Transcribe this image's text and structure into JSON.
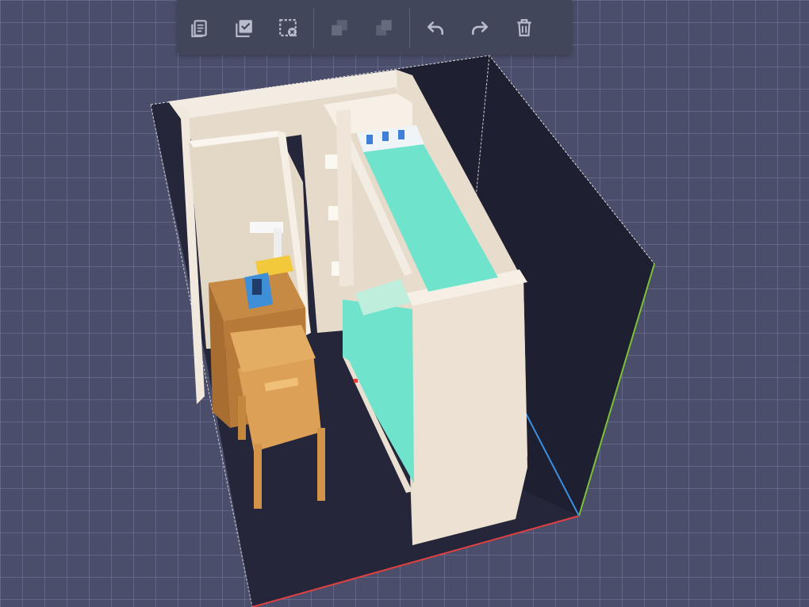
{
  "app": {
    "view": "3d-voxel-editor"
  },
  "toolbar": {
    "groups": [
      [
        {
          "name": "copy-button",
          "icon": "copy-document-icon",
          "enabled": true
        },
        {
          "name": "select-all-button",
          "icon": "select-all-icon",
          "enabled": true
        },
        {
          "name": "deselect-button",
          "icon": "deselect-icon",
          "enabled": true
        }
      ],
      [
        {
          "name": "bring-to-front-button",
          "icon": "bring-to-front-icon",
          "enabled": false
        },
        {
          "name": "send-to-back-button",
          "icon": "send-to-back-icon",
          "enabled": false
        }
      ],
      [
        {
          "name": "undo-button",
          "icon": "undo-icon",
          "enabled": true
        },
        {
          "name": "redo-button",
          "icon": "redo-icon",
          "enabled": true
        },
        {
          "name": "delete-button",
          "icon": "trash-icon",
          "enabled": true
        }
      ]
    ],
    "colors": {
      "enabled": "#b9bccb",
      "disabled": "#676b7e"
    }
  },
  "scene": {
    "colors": {
      "grid_background": "#4b4e6a",
      "room_floor": "#25263a",
      "wall": "#e6dacb",
      "wall_shadow": "#d4c6b5",
      "mattress": "#6fe3cc",
      "quilt_dots": "#e04a4a",
      "desk": "#c78a45",
      "chair": "#dca056",
      "axis_x": "#e04040",
      "axis_y": "#7ac234",
      "axis_z": "#3c8fe0"
    }
  }
}
